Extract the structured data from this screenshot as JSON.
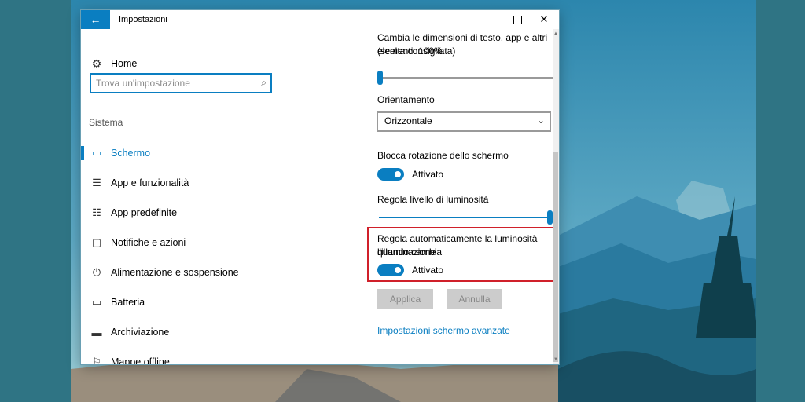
{
  "window": {
    "title": "Impostazioni",
    "back_icon": "←",
    "minimize_icon": "—",
    "close_icon": "✕"
  },
  "sidebar": {
    "home": {
      "icon": "⚙",
      "label": "Home"
    },
    "search": {
      "placeholder": "Trova un'impostazione",
      "icon": "⌕"
    },
    "section_title": "Sistema",
    "items": [
      {
        "icon": "▭",
        "label": "Schermo",
        "selected": true
      },
      {
        "icon": "☰",
        "label": "App e funzionalità"
      },
      {
        "icon": "☷",
        "label": "App predefinite"
      },
      {
        "icon": "▢",
        "label": "Notifiche e azioni"
      },
      {
        "icon": "⏻",
        "label": "Alimentazione e sospensione"
      },
      {
        "icon": "▭",
        "label": "Batteria"
      },
      {
        "icon": "▬",
        "label": "Archiviazione"
      },
      {
        "icon": "⚐",
        "label": "Mappe offline"
      }
    ]
  },
  "content": {
    "scale": {
      "label_line1": "Cambia le dimensioni di testo, app e altri elementi: 100%",
      "label_line2": "(scelta consigliata)",
      "slider_level": 0
    },
    "orientation": {
      "label": "Orientamento",
      "value": "Orizzontale",
      "chevron_icon": "⌄"
    },
    "rotation_lock": {
      "label": "Blocca rotazione dello schermo",
      "state": "Attivato"
    },
    "brightness": {
      "label": "Regola livello di luminosità",
      "slider_level": 1.0
    },
    "auto_brightness": {
      "label_line1": "Regola automaticamente la luminosità quando cambia",
      "label_line2": "l'illuminazione",
      "state": "Attivato"
    },
    "apply_label": "Applica",
    "cancel_label": "Annulla",
    "advanced_link": "Impostazioni schermo avanzate"
  },
  "colors": {
    "accent": "#0a7ec1",
    "highlight_border": "#d0202a"
  }
}
